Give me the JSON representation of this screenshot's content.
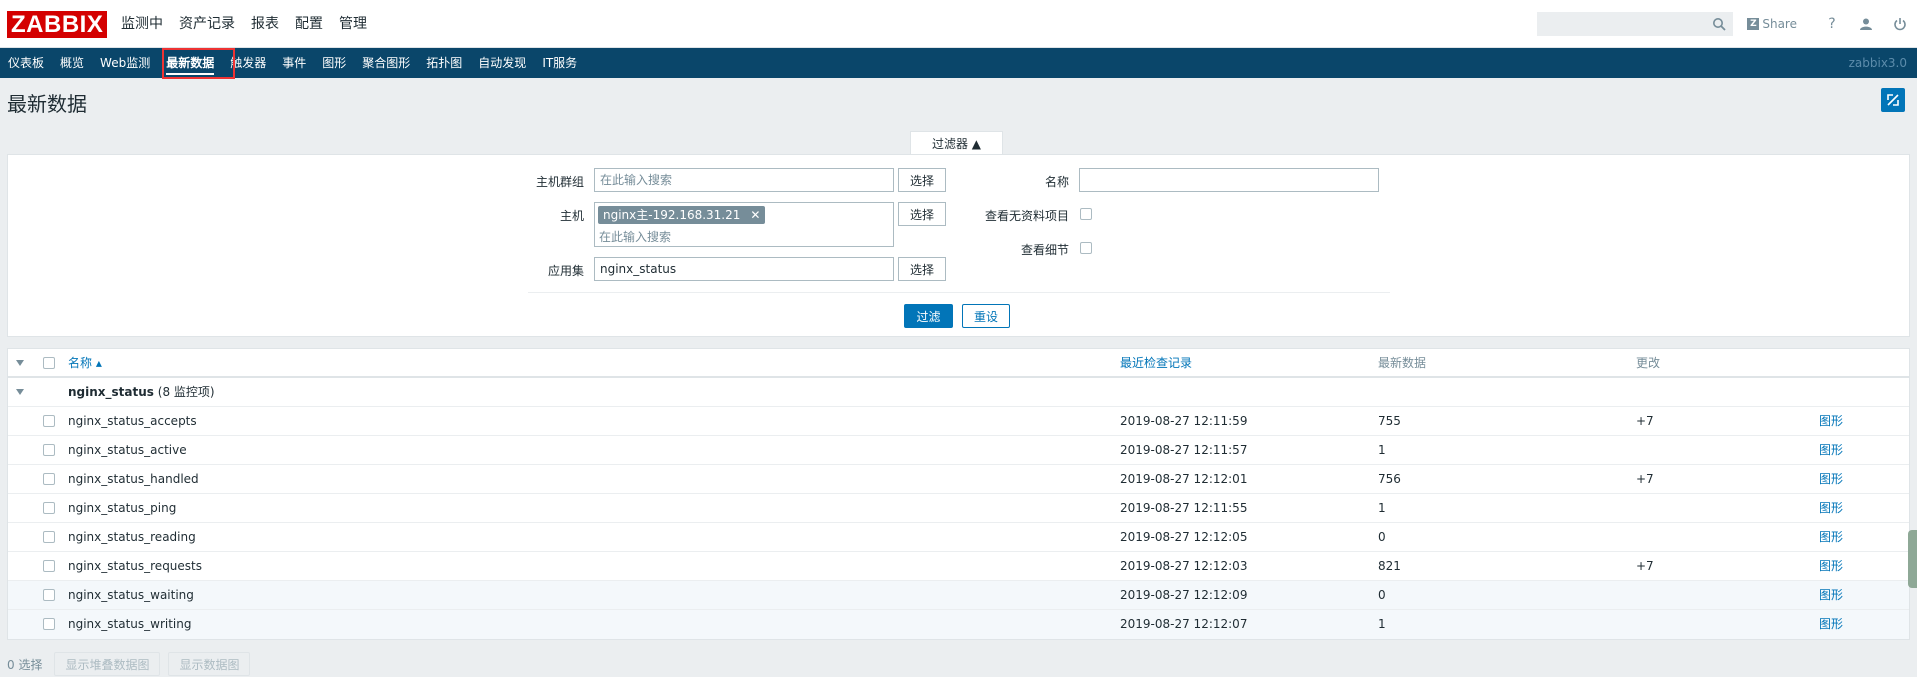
{
  "app": {
    "logo": "ZABBIX",
    "version": "zabbix3.0"
  },
  "topmenu": [
    "监测中",
    "资产记录",
    "报表",
    "配置",
    "管理"
  ],
  "topright": {
    "search_placeholder": "",
    "share": "Share",
    "help": "?"
  },
  "subnav": [
    "仪表板",
    "概览",
    "Web监测",
    "最新数据",
    "触发器",
    "事件",
    "图形",
    "聚合图形",
    "拓扑图",
    "自动发现",
    "IT服务"
  ],
  "page": {
    "title": "最新数据"
  },
  "filter": {
    "tab_label": "过滤器 ▲",
    "hostgroup_label": "主机群组",
    "hostgroup_placeholder": "在此输入搜索",
    "host_label": "主机",
    "host_chip": "nginx主-192.168.31.21",
    "host_placeholder": "在此输入搜索",
    "app_label": "应用集",
    "app_value": "nginx_status",
    "select_label": "选择",
    "name_label": "名称",
    "name_value": "",
    "no_data_label": "查看无资料项目",
    "details_label": "查看细节",
    "apply": "过滤",
    "reset": "重设"
  },
  "table": {
    "headers": {
      "name": "名称 ▴",
      "lastcheck": "最近检查记录",
      "lastvalue": "最新数据",
      "change": "更改"
    },
    "group": {
      "name": "nginx_status",
      "count": "(8 监控项)"
    },
    "rows": [
      {
        "name": "nginx_status_accepts",
        "lastcheck": "2019-08-27 12:11:59",
        "value": "755",
        "change": "+7",
        "graph": "图形"
      },
      {
        "name": "nginx_status_active",
        "lastcheck": "2019-08-27 12:11:57",
        "value": "1",
        "change": "",
        "graph": "图形"
      },
      {
        "name": "nginx_status_handled",
        "lastcheck": "2019-08-27 12:12:01",
        "value": "756",
        "change": "+7",
        "graph": "图形"
      },
      {
        "name": "nginx_status_ping",
        "lastcheck": "2019-08-27 12:11:55",
        "value": "1",
        "change": "",
        "graph": "图形"
      },
      {
        "name": "nginx_status_reading",
        "lastcheck": "2019-08-27 12:12:05",
        "value": "0",
        "change": "",
        "graph": "图形"
      },
      {
        "name": "nginx_status_requests",
        "lastcheck": "2019-08-27 12:12:03",
        "value": "821",
        "change": "+7",
        "graph": "图形"
      },
      {
        "name": "nginx_status_waiting",
        "lastcheck": "2019-08-27 12:12:09",
        "value": "0",
        "change": "",
        "graph": "图形"
      },
      {
        "name": "nginx_status_writing",
        "lastcheck": "2019-08-27 12:12:07",
        "value": "1",
        "change": "",
        "graph": "图形"
      }
    ]
  },
  "footer": {
    "selected": "0 选择",
    "stacked_graph": "显示堆叠数据图",
    "data_graph": "显示数据图"
  },
  "colors": {
    "brand": "#d40000",
    "nav": "#0a466a",
    "accent": "#0275b8"
  },
  "icons": {
    "search": "search-icon",
    "help": "help-icon",
    "user": "user-icon",
    "logout": "power-icon",
    "fullscreen": "fullscreen-icon"
  }
}
